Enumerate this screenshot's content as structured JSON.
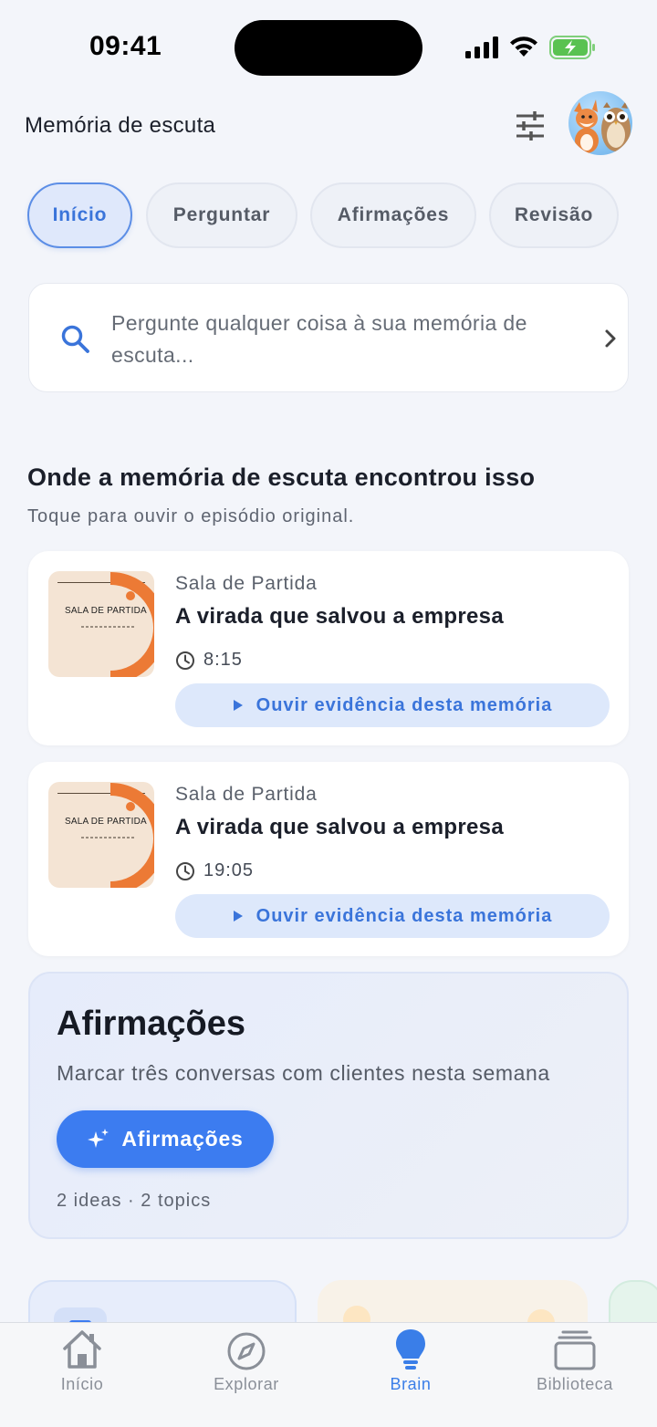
{
  "status_bar": {
    "time": "09:41"
  },
  "header": {
    "title": "Memória de escuta",
    "filter_icon": "sliders-icon",
    "avatar": "fox-and-owl-avatar"
  },
  "tabs": [
    {
      "label": "Início",
      "active": true
    },
    {
      "label": "Perguntar",
      "active": false
    },
    {
      "label": "Afirmações",
      "active": false
    },
    {
      "label": "Revisão",
      "active": false
    }
  ],
  "search": {
    "placeholder": "Pergunte qualquer coisa à sua memória de escuta..."
  },
  "section": {
    "title": "Onde a memória de escuta encontrou isso",
    "subtitle": "Toque para ouvir o episódio original."
  },
  "episodes": [
    {
      "thumb_title": "SALA DE PARTIDA",
      "show": "Sala de Partida",
      "title": "A virada que salvou a empresa",
      "time": "8:15",
      "button": "Ouvir evidência desta memória"
    },
    {
      "thumb_title": "SALA DE PARTIDA",
      "show": "Sala de Partida",
      "title": "A virada que salvou a empresa",
      "time": "19:05",
      "button": "Ouvir evidência desta memória"
    }
  ],
  "affirmations": {
    "title": "Afirmações",
    "text": "Marcar três conversas com clientes nesta semana",
    "button": "Afirmações",
    "meta": "2 ideas · 2 topics"
  },
  "tab_bar": [
    {
      "label": "Início",
      "icon": "home-icon",
      "active": false
    },
    {
      "label": "Explorar",
      "icon": "compass-icon",
      "active": false
    },
    {
      "label": "Brain",
      "icon": "lightbulb-icon",
      "active": true
    },
    {
      "label": "Biblioteca",
      "icon": "library-icon",
      "active": false
    }
  ],
  "colors": {
    "accent": "#3a7ee8",
    "background": "#f3f5fa",
    "thumb_orange": "#ec7a35"
  }
}
